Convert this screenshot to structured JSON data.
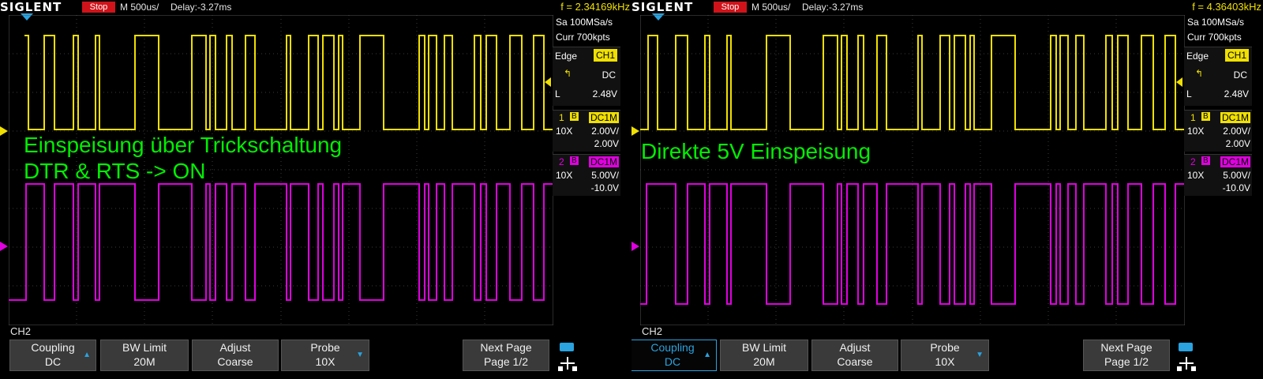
{
  "scopes": [
    {
      "logo": "SIGLENT",
      "stop": "Stop",
      "timebase": "M 500us/",
      "delay": "Delay:-3.27ms",
      "freq": "f = 2.34169kHz",
      "sample_rate": "Sa 100MSa/s",
      "curr": "Curr 700kpts",
      "trigger": {
        "mode": "Edge",
        "source": "CH1",
        "coupling": "DC",
        "level_label": "L",
        "level": "2.48V"
      },
      "ch1": {
        "num": "1",
        "b": "B",
        "coupling": "DC1M",
        "probe": "10X",
        "vdiv": "2.00V/",
        "offset": "2.00V"
      },
      "ch2": {
        "num": "2",
        "b": "B",
        "coupling": "DC1M",
        "probe": "10X",
        "vdiv": "5.00V/",
        "offset": "-10.0V"
      },
      "annotation": [
        "Einspeisung über Trickschaltung",
        "DTR & RTS -> ON"
      ],
      "ch_label": "CH2",
      "softkeys": [
        {
          "title": "Coupling",
          "value": "DC"
        },
        {
          "title": "BW Limit",
          "value": "20M"
        },
        {
          "title": "Adjust",
          "value": "Coarse"
        },
        {
          "title": "Probe",
          "value": "10X"
        },
        {
          "title": "Next Page",
          "value": "Page 1/2"
        }
      ]
    },
    {
      "logo": "SIGLENT",
      "stop": "Stop",
      "timebase": "M 500us/",
      "delay": "Delay:-3.27ms",
      "freq": "f = 4.36403kHz",
      "sample_rate": "Sa 100MSa/s",
      "curr": "Curr 700kpts",
      "trigger": {
        "mode": "Edge",
        "source": "CH1",
        "coupling": "DC",
        "level_label": "L",
        "level": "2.48V"
      },
      "ch1": {
        "num": "1",
        "b": "B",
        "coupling": "DC1M",
        "probe": "10X",
        "vdiv": "2.00V/",
        "offset": "2.00V"
      },
      "ch2": {
        "num": "2",
        "b": "B",
        "coupling": "DC1M",
        "probe": "10X",
        "vdiv": "5.00V/",
        "offset": "-10.0V"
      },
      "annotation": [
        "Direkte 5V Einspeisung"
      ],
      "ch_label": "CH2",
      "softkeys": [
        {
          "title": "Coupling",
          "value": "DC"
        },
        {
          "title": "BW Limit",
          "value": "20M"
        },
        {
          "title": "Adjust",
          "value": "Coarse"
        },
        {
          "title": "Probe",
          "value": "10X"
        },
        {
          "title": "Next Page",
          "value": "Page 1/2"
        }
      ]
    }
  ],
  "colors": {
    "ch1": "#f0e000",
    "ch2": "#e000e0",
    "annotation": "#00ef00",
    "accent": "#2aa3e0",
    "stop": "#d0131a"
  }
}
